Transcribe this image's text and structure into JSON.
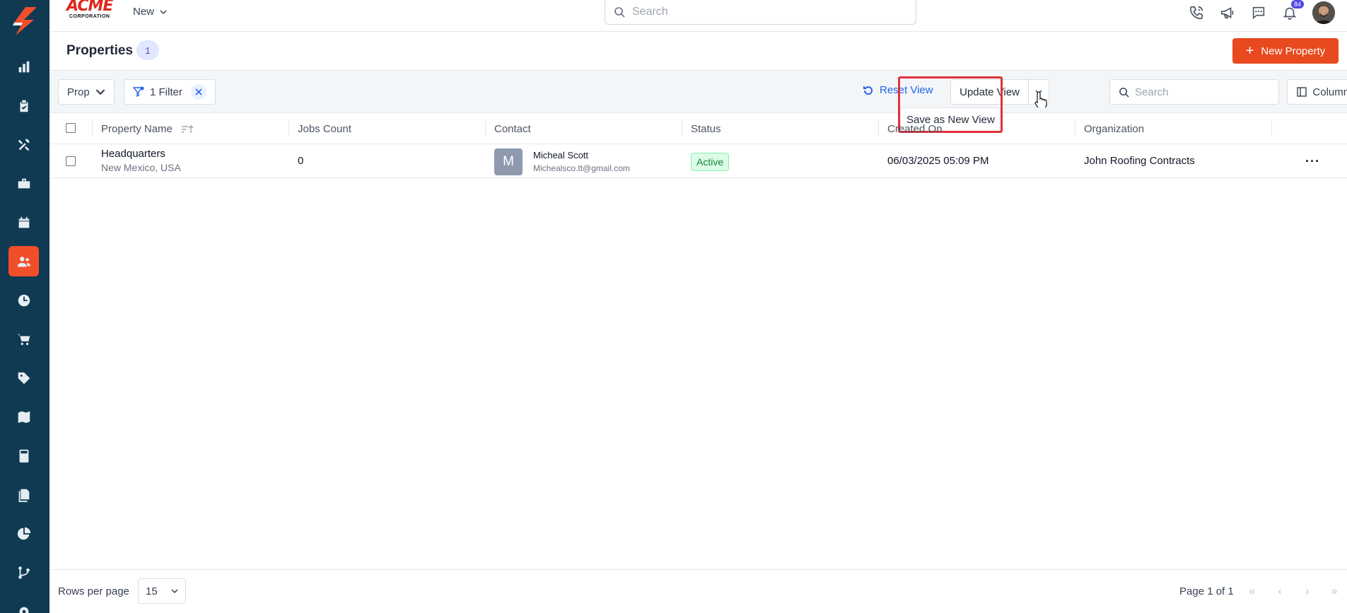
{
  "brand": {
    "name": "ACME",
    "sub": "CORPORATION",
    "accent": "#f04f2a"
  },
  "topbar": {
    "new_label": "New",
    "search_placeholder": "Search",
    "notification_count": "84",
    "icons": [
      "phone-icon",
      "megaphone-icon",
      "chat-icon",
      "bell-icon"
    ]
  },
  "sidebar": {
    "items": [
      {
        "icon": "bar-chart-icon"
      },
      {
        "icon": "clipboard-check-icon"
      },
      {
        "icon": "tools-icon"
      },
      {
        "icon": "briefcase-icon"
      },
      {
        "icon": "calendar-icon"
      },
      {
        "icon": "users-icon",
        "active": true
      },
      {
        "icon": "clock-icon"
      },
      {
        "icon": "cart-icon"
      },
      {
        "icon": "tag-icon"
      },
      {
        "icon": "map-icon"
      },
      {
        "icon": "calculator-icon"
      },
      {
        "icon": "documents-icon"
      },
      {
        "icon": "pie-chart-icon"
      },
      {
        "icon": "git-branch-icon"
      },
      {
        "icon": "gear-icon"
      }
    ]
  },
  "page": {
    "title": "Properties",
    "count": "1",
    "new_button": "New Property"
  },
  "toolbar": {
    "view_select": "Prop",
    "filter_label": "1 Filter",
    "reset_view": "Reset View",
    "update_view": "Update View",
    "dropdown_item": "Save as New View",
    "search_placeholder": "Search",
    "columns_label": "Columns",
    "more_label": "···"
  },
  "table": {
    "headers": {
      "property_name": "Property Name",
      "jobs_count": "Jobs Count",
      "contact": "Contact",
      "status": "Status",
      "created_on": "Created On",
      "organization": "Organization"
    },
    "rows": [
      {
        "name": "Headquarters",
        "location": "New Mexico, USA",
        "jobs_count": "0",
        "contact_initial": "M",
        "contact_name": "Micheal Scott",
        "contact_email": "Michealsco.tt@gmail.com",
        "status": "Active",
        "created_on": "06/03/2025 05:09 PM",
        "organization": "John Roofing Contracts",
        "actions": "···"
      }
    ]
  },
  "footer": {
    "rows_per_page_label": "Rows per page",
    "rows_per_page_value": "15",
    "page_info": "Page 1 of 1"
  }
}
